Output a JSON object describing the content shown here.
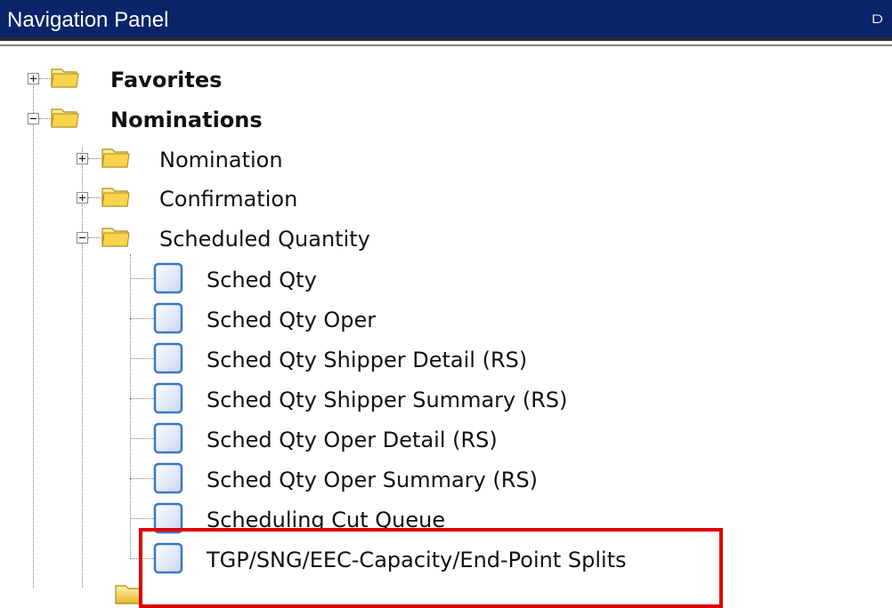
{
  "panel": {
    "title": "Navigation Panel",
    "pin_icon": "pin-icon"
  },
  "tree": {
    "favorites": {
      "label": "Favorites",
      "icon": "folder-icon",
      "expanded": false
    },
    "nominations": {
      "label": "Nominations",
      "icon": "folder-icon",
      "expanded": true,
      "children": {
        "nomination": {
          "label": "Nomination",
          "icon": "folder-icon",
          "expanded": false
        },
        "confirmation": {
          "label": "Confirmation",
          "icon": "folder-icon",
          "expanded": false
        },
        "scheduled_quantity": {
          "label": "Scheduled Quantity",
          "icon": "folder-icon",
          "expanded": true,
          "items": [
            {
              "label": "Sched Qty",
              "icon": "page-icon"
            },
            {
              "label": "Sched Qty Oper",
              "icon": "page-icon"
            },
            {
              "label": "Sched Qty Shipper Detail (RS)",
              "icon": "page-icon"
            },
            {
              "label": "Sched Qty Shipper Summary (RS)",
              "icon": "page-icon"
            },
            {
              "label": "Sched Qty Oper Detail (RS)",
              "icon": "page-icon"
            },
            {
              "label": "Sched Qty Oper Summary (RS)",
              "icon": "page-icon"
            },
            {
              "label": "Scheduling Cut Queue",
              "icon": "page-icon"
            },
            {
              "label": "TGP/SNG/EEC-Capacity/End-Point Splits",
              "icon": "page-icon"
            }
          ]
        }
      }
    }
  },
  "colors": {
    "titlebar": "#0a246a",
    "highlight": "#e00000"
  }
}
